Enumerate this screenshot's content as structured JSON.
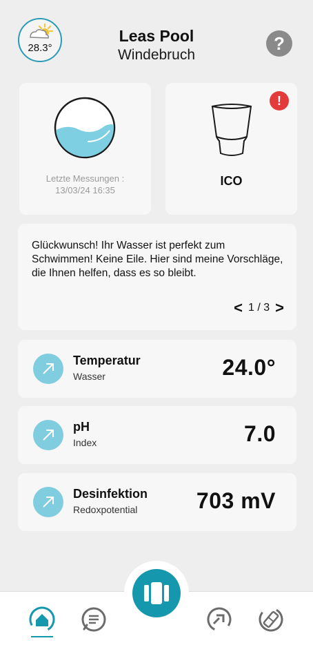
{
  "header": {
    "weather_temp": "28.3°",
    "weather_icon": "partly-sunny-icon",
    "title": "Leas Pool",
    "subtitle": "Windebruch",
    "help_label": "?"
  },
  "water_card": {
    "icon": "water-wave-icon",
    "last_measurement_label": "Letzte Messungen :",
    "last_measurement_date": "13/03/24 16:35"
  },
  "device_card": {
    "icon": "cup-device-icon",
    "alert_label": "!",
    "name": "ICO"
  },
  "message_card": {
    "text": "Glückwunsch! Ihr Wasser ist perfekt zum Schwimmen! Keine Eile. Hier sind meine Vorschläge, die Ihnen helfen, dass es so bleibt.",
    "page": "1 / 3",
    "prev": "<",
    "next": ">"
  },
  "metrics": [
    {
      "title": "Temperatur",
      "subtitle": "Wasser",
      "value": "24.0°",
      "icon": "trend-up-arrow-icon"
    },
    {
      "title": "pH",
      "subtitle": "Index",
      "value": "7.0",
      "icon": "trend-up-arrow-icon"
    },
    {
      "title": "Desinfektion",
      "subtitle": "Redoxpotential",
      "value": "703 mV",
      "icon": "trend-up-arrow-icon"
    }
  ],
  "bottom_nav": {
    "items": [
      "home-icon",
      "chat-icon",
      "gauge-icon",
      "tools-icon"
    ],
    "center_button": "device-center-icon"
  },
  "colors": {
    "accent": "#1597ad",
    "metric_icon_bg": "#80cde0",
    "water": "#7fcfe3",
    "alert": "#e33b3b",
    "background": "#eeeeee",
    "card": "#f7f7f7"
  }
}
